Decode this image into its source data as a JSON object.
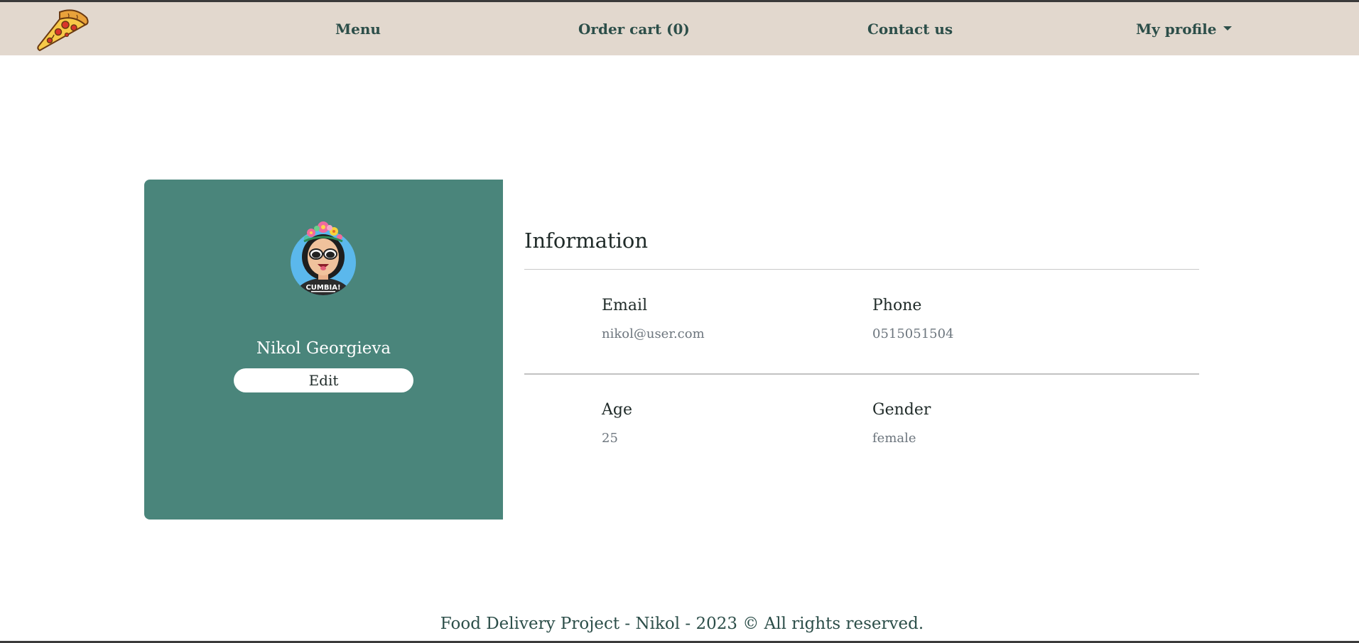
{
  "nav": {
    "menu": "Menu",
    "cart": "Order cart (0)",
    "contact": "Contact us",
    "profile": "My profile"
  },
  "profile": {
    "name": "Nikol Georgieva",
    "edit_label": "Edit",
    "avatar_badge_text": "CUMBIA!"
  },
  "info": {
    "title": "Information",
    "fields": [
      {
        "label": "Email",
        "value": "nikol@user.com"
      },
      {
        "label": "Phone",
        "value": "0515051504"
      },
      {
        "label": "Age",
        "value": "25"
      },
      {
        "label": "Gender",
        "value": "female"
      }
    ]
  },
  "footer": {
    "text": "Food Delivery Project - Nikol - 2023 © All rights reserved."
  },
  "colors": {
    "navbar_bg": "#e2d8ce",
    "nav_text": "#2c4e49",
    "card_bg": "#4a857b",
    "muted_text": "#6c757d"
  },
  "icons": {
    "logo": "pizza-slice-icon",
    "profile_caret": "caret-down-icon"
  }
}
